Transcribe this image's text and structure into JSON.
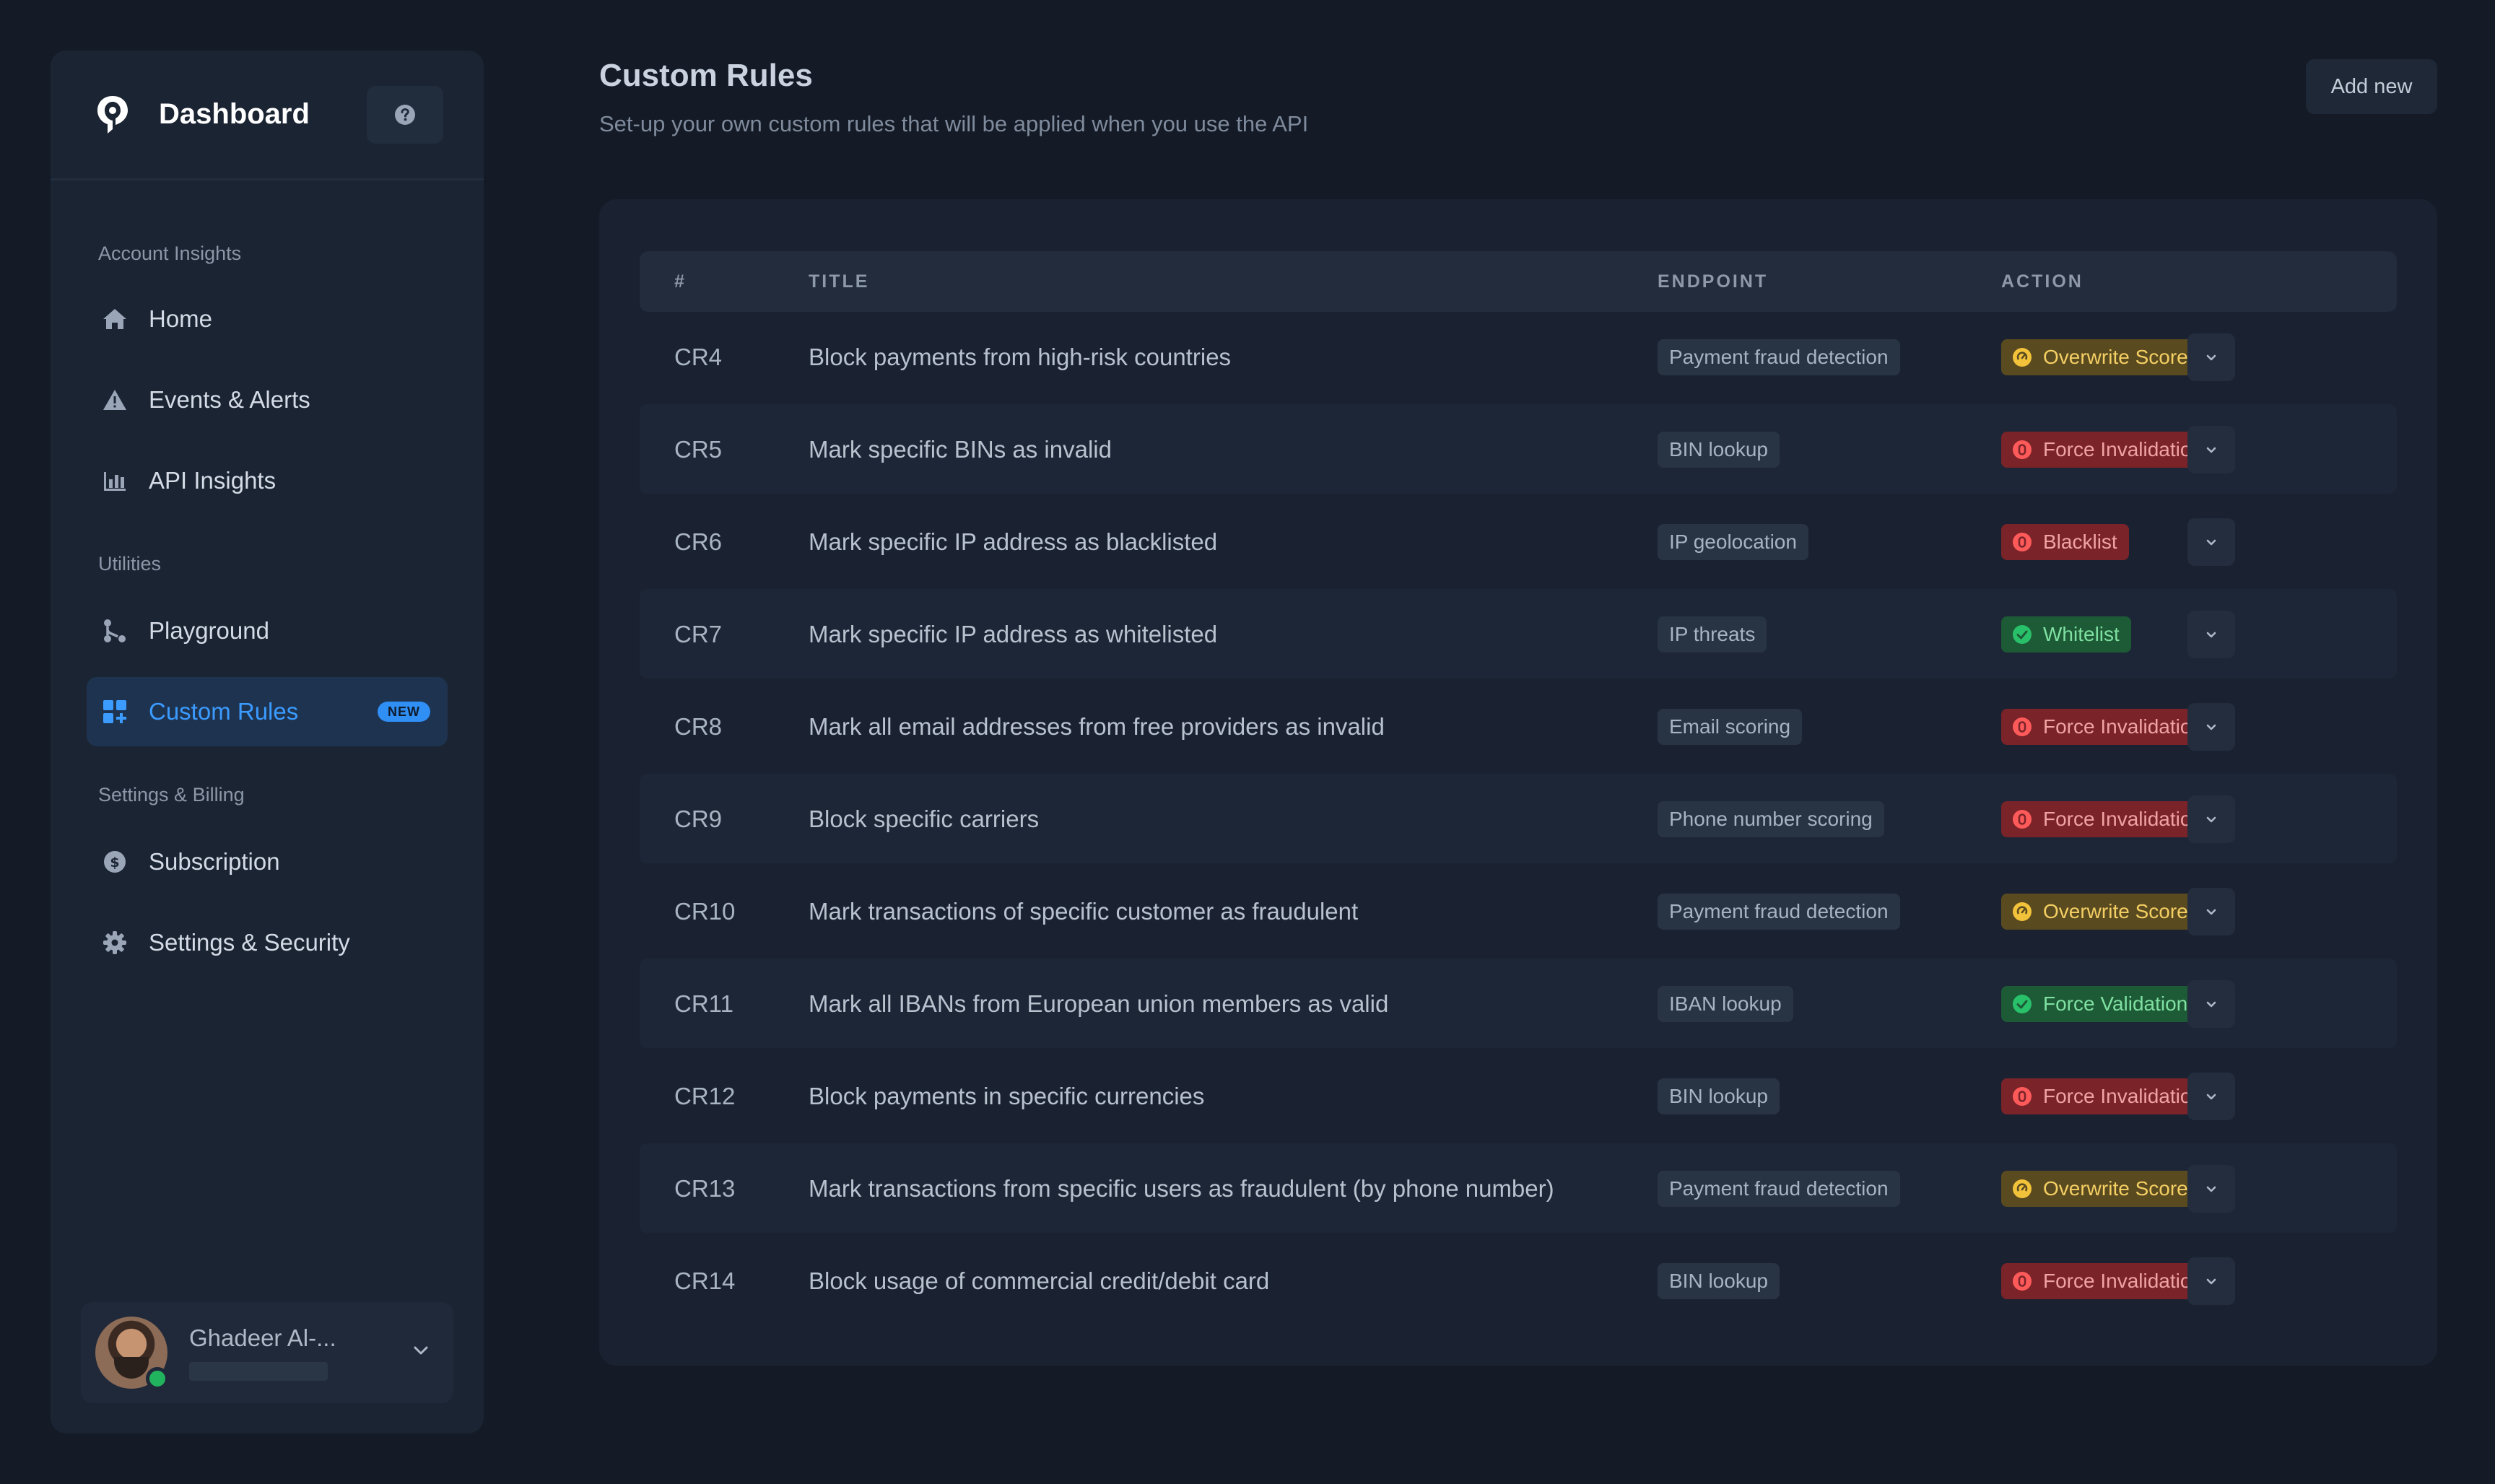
{
  "brand": {
    "name": "Dashboard"
  },
  "sidebar": {
    "sections": [
      {
        "label": "Account Insights"
      },
      {
        "label": "Utilities"
      },
      {
        "label": "Settings & Billing"
      }
    ],
    "items": [
      {
        "label": "Home",
        "icon": "home-icon"
      },
      {
        "label": "Events & Alerts",
        "icon": "alert-triangle-icon"
      },
      {
        "label": "API Insights",
        "icon": "bar-chart-icon"
      },
      {
        "label": "Playground",
        "icon": "git-branch-icon"
      },
      {
        "label": "Custom Rules",
        "icon": "grid-plus-icon",
        "active": true,
        "badge": "NEW"
      },
      {
        "label": "Subscription",
        "icon": "dollar-circle-icon"
      },
      {
        "label": "Settings & Security",
        "icon": "gear-icon"
      }
    ],
    "user": {
      "name": "Ghadeer Al-..."
    }
  },
  "header": {
    "title": "Custom Rules",
    "subtitle": "Set-up your own custom rules that will be applied when you use the API",
    "add_label": "Add new"
  },
  "table": {
    "columns": [
      "#",
      "TITLE",
      "ENDPOINT",
      "ACTION"
    ],
    "rows": [
      {
        "id": "CR4",
        "title": "Block payments from high-risk countries",
        "endpoint": "Payment fraud detection",
        "action": "Overwrite Score",
        "tone": "yellow"
      },
      {
        "id": "CR5",
        "title": "Mark specific BINs as invalid",
        "endpoint": "BIN lookup",
        "action": "Force Invalidation",
        "tone": "red"
      },
      {
        "id": "CR6",
        "title": "Mark specific IP address as blacklisted",
        "endpoint": "IP geolocation",
        "action": "Blacklist",
        "tone": "red"
      },
      {
        "id": "CR7",
        "title": "Mark specific IP address as whitelisted",
        "endpoint": "IP threats",
        "action": "Whitelist",
        "tone": "green"
      },
      {
        "id": "CR8",
        "title": "Mark all email addresses from free providers as invalid",
        "endpoint": "Email scoring",
        "action": "Force Invalidation",
        "tone": "red"
      },
      {
        "id": "CR9",
        "title": "Block specific carriers",
        "endpoint": "Phone number scoring",
        "action": "Force Invalidation",
        "tone": "red"
      },
      {
        "id": "CR10",
        "title": "Mark transactions of specific customer as fraudulent",
        "endpoint": "Payment fraud detection",
        "action": "Overwrite Score",
        "tone": "yellow"
      },
      {
        "id": "CR11",
        "title": "Mark all IBANs from European union members as valid",
        "endpoint": "IBAN lookup",
        "action": "Force Validation",
        "tone": "green"
      },
      {
        "id": "CR12",
        "title": "Block payments in specific currencies",
        "endpoint": "BIN lookup",
        "action": "Force Invalidation",
        "tone": "red"
      },
      {
        "id": "CR13",
        "title": "Mark transactions from specific users as fraudulent (by phone number)",
        "endpoint": "Payment fraud detection",
        "action": "Overwrite Score",
        "tone": "yellow"
      },
      {
        "id": "CR14",
        "title": "Block usage of commercial credit/debit card",
        "endpoint": "BIN lookup",
        "action": "Force Invalidation",
        "tone": "red"
      }
    ]
  },
  "colors": {
    "background": "#141b27",
    "accent": "#3b9bff",
    "danger": "#ff5a5a",
    "warning": "#f2c23b",
    "success": "#29c06a"
  }
}
